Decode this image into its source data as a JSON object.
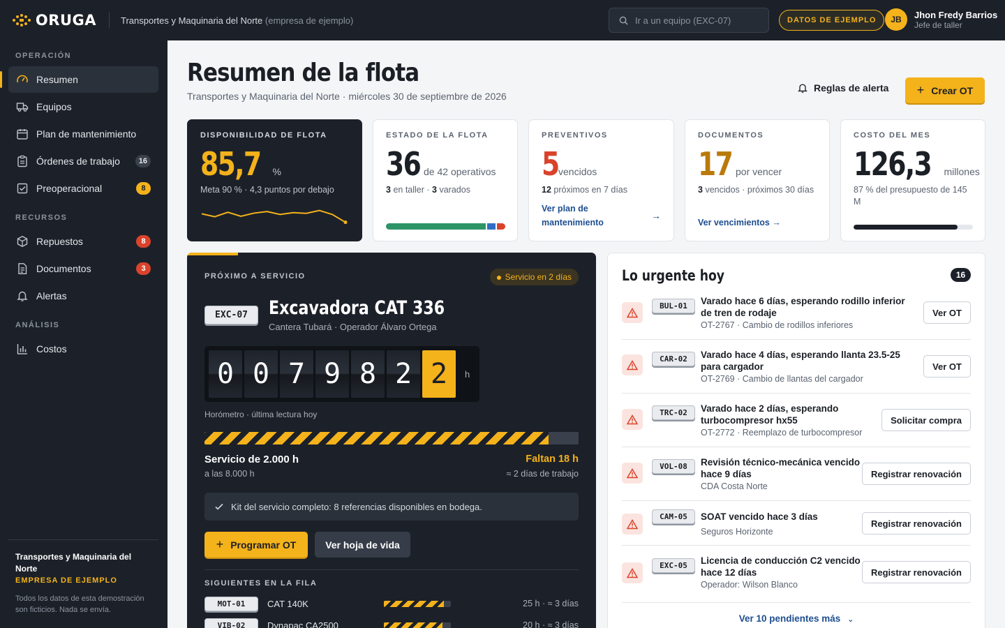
{
  "app": {
    "brand": "ORUGA",
    "company": "Transportes y Maquinaria del Norte",
    "company_note": "(empresa de ejemplo)",
    "search_placeholder": "Ir a un equipo (EXC-07)",
    "demo_badge": "DATOS DE EJEMPLO",
    "user": {
      "initials": "JB",
      "name": "Jhon Fredy Barrios",
      "role": "Jefe de taller"
    }
  },
  "sidebar": {
    "section_operacion": "OPERACIÓN",
    "section_recursos": "RECURSOS",
    "section_analisis": "ANÁLISIS",
    "items": [
      {
        "label": "Resumen",
        "icon": "gauge-icon"
      },
      {
        "label": "Equipos",
        "icon": "truck-icon"
      },
      {
        "label": "Plan de mantenimiento",
        "icon": "calendar-icon"
      },
      {
        "label": "Órdenes de trabajo",
        "icon": "clipboard-icon",
        "count": "16"
      },
      {
        "label": "Preoperacional",
        "icon": "checkbox-icon",
        "count": "8"
      },
      {
        "label": "Repuestos",
        "icon": "box-icon",
        "count": "8"
      },
      {
        "label": "Documentos",
        "icon": "document-icon",
        "count": "3"
      },
      {
        "label": "Alertas",
        "icon": "bell-icon"
      },
      {
        "label": "Costos",
        "icon": "bar-chart-icon"
      }
    ],
    "footer": {
      "title": "Transportes y Maquinaria del Norte",
      "tag": "EMPRESA DE EJEMPLO",
      "note": "Todos los datos de esta demostración son ficticios. Nada se envía."
    }
  },
  "header": {
    "title": "Resumen de la flota",
    "subtitle": "Transportes y Maquinaria del Norte · miércoles 30 de septiembre de 2026",
    "alert_rules": "Reglas de alerta",
    "create_ot": "Crear OT"
  },
  "kpis": {
    "availability": {
      "label": "DISPONIBILIDAD DE FLOTA",
      "value": "85,7",
      "unit": "%",
      "note": "Meta 90 % · 4,3 puntos por debajo",
      "trend": [
        0.55,
        0.42,
        0.62,
        0.44,
        0.58,
        0.65,
        0.52,
        0.6,
        0.57,
        0.7,
        0.52,
        0.17
      ]
    },
    "fleet": {
      "label": "ESTADO DE LA FLOTA",
      "value": "36",
      "unit": "de 42 operativos",
      "taller": "3",
      "taller_label": "en taller",
      "varados": "3",
      "varados_label": "varados"
    },
    "preventive": {
      "label": "PREVENTIVOS",
      "value": "5",
      "unit": "vencidos",
      "upcoming": "12",
      "upcoming_label": "próximos en 7 días",
      "link": "Ver plan de mantenimiento"
    },
    "documents": {
      "label": "DOCUMENTOS",
      "value": "17",
      "unit": "por vencer",
      "expired": "3",
      "expired_label": "vencidos · próximos 30 días",
      "link": "Ver vencimientos"
    },
    "cost": {
      "label": "COSTO DEL MES",
      "value": "126,3",
      "unit": "millones",
      "note": "87 % del presupuesto de 145 M",
      "budget_fraction": 0.87
    }
  },
  "service": {
    "label": "PRÓXIMO A SERVICIO",
    "pill": "Servicio en 2 días",
    "plate": "EXC-07",
    "name": "Excavadora CAT 336",
    "location": "Cantera Tubará · Operador Álvaro Ortega",
    "odometer": [
      "0",
      "0",
      "7",
      "9",
      "8",
      "2",
      "2"
    ],
    "odometer_unit": "h",
    "odometer_note": "Horómetro · última lectura hoy",
    "progress": 0.92,
    "schedule": "Servicio de 2.000 h",
    "schedule_sub": "a las 8.000 h",
    "remaining": "Faltan 18 h",
    "remaining_sub": "≈ 2 días de trabajo",
    "kit": "Kit del servicio completo: 8 referencias disponibles en bodega.",
    "btn_program": "Programar OT",
    "btn_history": "Ver hoja de vida",
    "queue_label": "SIGUIENTES EN LA FILA",
    "queue": [
      {
        "plate": "MOT-01",
        "name": "CAT 140K",
        "progress": 0.9,
        "info": "25 h · ≈ 3 días"
      },
      {
        "plate": "VIB-02",
        "name": "Dynapac CA2500",
        "progress": 0.88,
        "info": "20 h · ≈ 3 días"
      }
    ]
  },
  "urgent": {
    "title": "Lo urgente hoy",
    "count": "16",
    "items": [
      {
        "plate": "BUL-01",
        "title": "Varado hace 6 días, esperando rodillo inferior de tren de rodaje",
        "sub": "OT-2767 · Cambio de rodillos inferiores",
        "action": "Ver OT"
      },
      {
        "plate": "CAR-02",
        "title": "Varado hace 4 días, esperando llanta 23.5-25 para cargador",
        "sub": "OT-2769 · Cambio de llantas del cargador",
        "action": "Ver OT"
      },
      {
        "plate": "TRC-02",
        "title": "Varado hace 2 días, esperando turbocompresor hx55",
        "sub": "OT-2772 · Reemplazo de turbocompresor",
        "action": "Solicitar compra"
      },
      {
        "plate": "VOL-08",
        "title": "Revisión técnico-mecánica vencido hace 9 días",
        "sub": "CDA Costa Norte",
        "action": "Registrar renovación"
      },
      {
        "plate": "CAM-05",
        "title": "SOAT vencido hace 3 días",
        "sub": "Seguros Horizonte",
        "action": "Registrar renovación"
      },
      {
        "plate": "EXC-05",
        "title": "Licencia de conducción C2 vencido hace 12 días",
        "sub": "Operador: Wilson Blanco",
        "action": "Registrar renovación"
      }
    ],
    "more": "Ver 10 pendientes más"
  },
  "colors": {
    "accent": "#f4b21b",
    "dark": "#1c2129",
    "danger": "#d9432b",
    "ok": "#2e9466",
    "link": "#1d4e8f"
  }
}
